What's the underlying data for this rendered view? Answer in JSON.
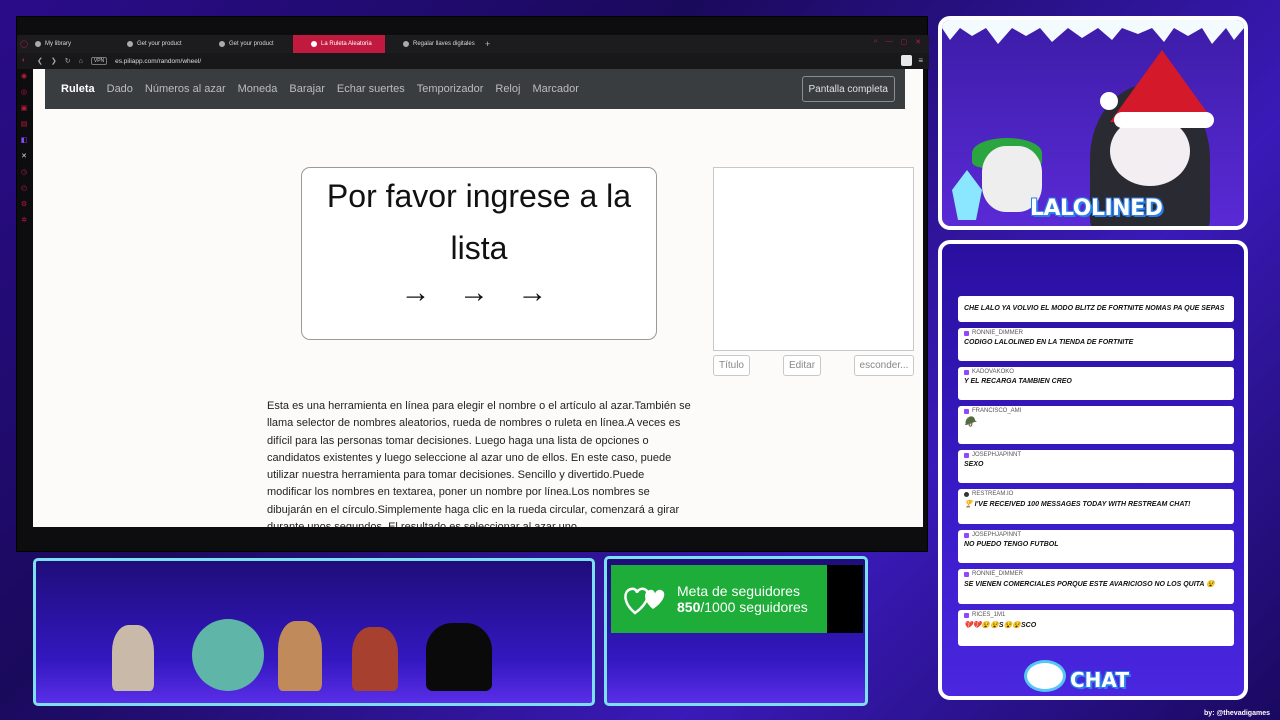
{
  "browser": {
    "tabs": [
      {
        "label": "My library",
        "active": false
      },
      {
        "label": "Get your product",
        "active": false
      },
      {
        "label": "Get your product",
        "active": false
      },
      {
        "label": "La Ruleta Aleatoria",
        "active": true
      },
      {
        "label": "Regalar llaves digitales",
        "active": false
      }
    ],
    "new_tab": "+",
    "vpn_label": "VPN",
    "url": "es.piliapp.com/random/wheel/"
  },
  "nav": {
    "items": [
      "Ruleta",
      "Dado",
      "Números al azar",
      "Moneda",
      "Barajar",
      "Echar suertes",
      "Temporizador",
      "Reloj",
      "Marcador"
    ],
    "active_index": 0,
    "fullscreen_label": "Pantalla completa"
  },
  "wheel": {
    "message": "Por favor ingrese a la lista",
    "arrows": "→ → →"
  },
  "controls": {
    "title_label": "Título",
    "edit_label": "Editar",
    "hide_label": "esconder..."
  },
  "description": "Esta es una herramienta en línea para elegir el nombre o el artículo al azar.También se llama selector de nombres aleatorios, rueda de nombres o ruleta en línea.A veces es difícil para las personas tomar decisiones. Luego haga una lista de opciones o candidatos existentes y luego seleccione al azar uno de ellos. En este caso, puede utilizar nuestra herramienta para tomar decisiones. Sencillo y divertido.Puede modificar los nombres en textarea, poner un nombre por línea.Los nombres se dibujarán en el círculo.Simplemente haga clic en la rueda circular, comenzará a girar durante unos segundos. El resultado es seleccionar al azar uno",
  "goal": {
    "title": "Meta de seguidores",
    "current": "850",
    "total_text": "/1000 seguidores",
    "progress": 0.85
  },
  "cam": {
    "name": "LALOLINED"
  },
  "chat": {
    "messages": [
      {
        "user": "",
        "text": "CHE LALO YA VOLVIO EL MODO BLITZ DE FORTNITE NOMAS PA QUE SEPAS"
      },
      {
        "user": "RONNIE_DIMMER",
        "text": "CODIGO LALOLINED EN LA TIENDA DE FORTNITE"
      },
      {
        "user": "KADOVAKOKO",
        "text": "Y EL RECARGA TAMBIEN CREO"
      },
      {
        "user": "FRANCISCO_AMI",
        "text": "🪖"
      },
      {
        "user": "JOSEPHJAPINNT",
        "text": "SEXO"
      },
      {
        "user": "RESTREAM.IO",
        "text": "🏆 I'VE RECEIVED 100 MESSAGES TODAY WITH RESTREAM CHAT!"
      },
      {
        "user": "JOSEPHJAPINNT",
        "text": "NO PUEDO TENGO FUTBOL"
      },
      {
        "user": "RONNIE_DIMMER",
        "text": "SE VIENEN COMERCIALES PORQUE ESTE AVARICIOSO NO LOS QUITA 😵"
      },
      {
        "user": "RICES_1M1",
        "text": "💔💔😵😵S😵😵SCO"
      }
    ],
    "label": "CHAT"
  },
  "credit": "by: @thevadigames",
  "colors": {
    "tab_active": "#c2193f",
    "navbar": "#3a3d40",
    "goal_green": "#1dad38",
    "panel_border": "#7de0ef"
  }
}
